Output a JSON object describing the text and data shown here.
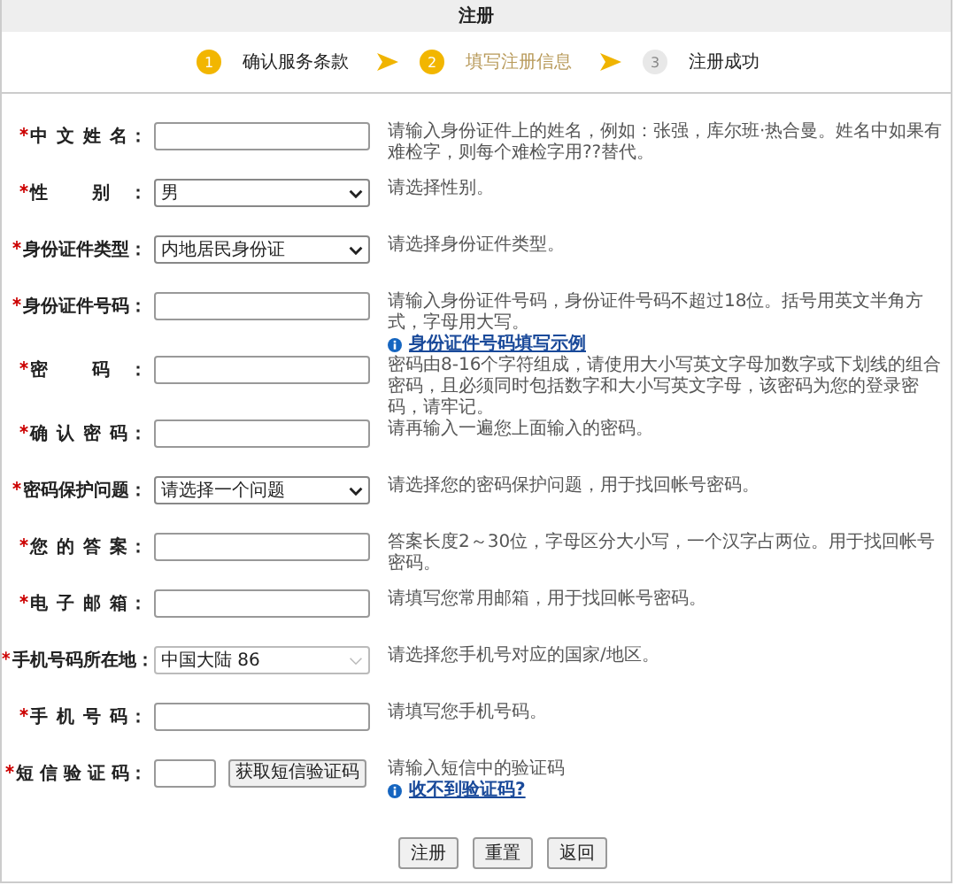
{
  "title": "注册",
  "steps": [
    {
      "number": "1",
      "label": "确认服务条款",
      "reached": true,
      "current": false
    },
    {
      "number": "2",
      "label": "填写注册信息",
      "reached": true,
      "current": true
    },
    {
      "number": "3",
      "label": "注册成功",
      "reached": false,
      "current": false
    }
  ],
  "fields": [
    {
      "kind": "text",
      "required": true,
      "label": "中 文 姓 名：",
      "hint": "请输入身份证件上的姓名，例如：张强，库尔班·热合曼。姓名中如果有难检字，则每个难检字用??替代。"
    },
    {
      "kind": "select",
      "required": true,
      "label": "性 别：",
      "value": "男",
      "hint": "请选择性别。"
    },
    {
      "kind": "select",
      "required": true,
      "label": "身份证件类型：",
      "value": "内地居民身份证",
      "hint": "请选择身份证件类型。"
    },
    {
      "kind": "text",
      "required": true,
      "label": "身份证件号码：",
      "hint": "请输入身份证件号码，身份证件号码不超过18位。括号用英文半角方式，字母用大写。",
      "link": "身份证件号码填写示例"
    },
    {
      "kind": "text",
      "required": true,
      "label": "密 码：",
      "hint": "密码由8-16个字符组成，请使用大小写英文字母加数字或下划线的组合密码，且必须同时包括数字和大小写英文字母，该密码为您的登录密码，请牢记。"
    },
    {
      "kind": "text",
      "required": true,
      "label": "确 认 密 码：",
      "hint": "请再输入一遍您上面输入的密码。"
    },
    {
      "kind": "select",
      "required": true,
      "label": "密码保护问题：",
      "value": "请选择一个问题",
      "hint": "请选择您的密码保护问题，用于找回帐号密码。"
    },
    {
      "kind": "text",
      "required": true,
      "label": "您 的 答 案：",
      "hint": "答案长度2～30位，字母区分大小写，一个汉字占两位。用于找回帐号密码。"
    },
    {
      "kind": "text",
      "required": true,
      "label": "电 子 邮 箱：",
      "hint": "请填写您常用邮箱，用于找回帐号密码。"
    },
    {
      "kind": "combo",
      "required": true,
      "label": "手机号码所在地：",
      "value": "中国大陆 86",
      "hint": "请选择您手机号对应的国家/地区。"
    },
    {
      "kind": "text",
      "required": true,
      "label": "手 机 号 码：",
      "hint": "请填写您手机号码。"
    },
    {
      "kind": "sms",
      "required": true,
      "label": "短 信 验 证 码：",
      "button": "获取短信验证码",
      "hint": "请输入短信中的验证码",
      "link": "收不到验证码?"
    }
  ],
  "buttons": [
    "注册",
    "重置",
    "返回"
  ]
}
